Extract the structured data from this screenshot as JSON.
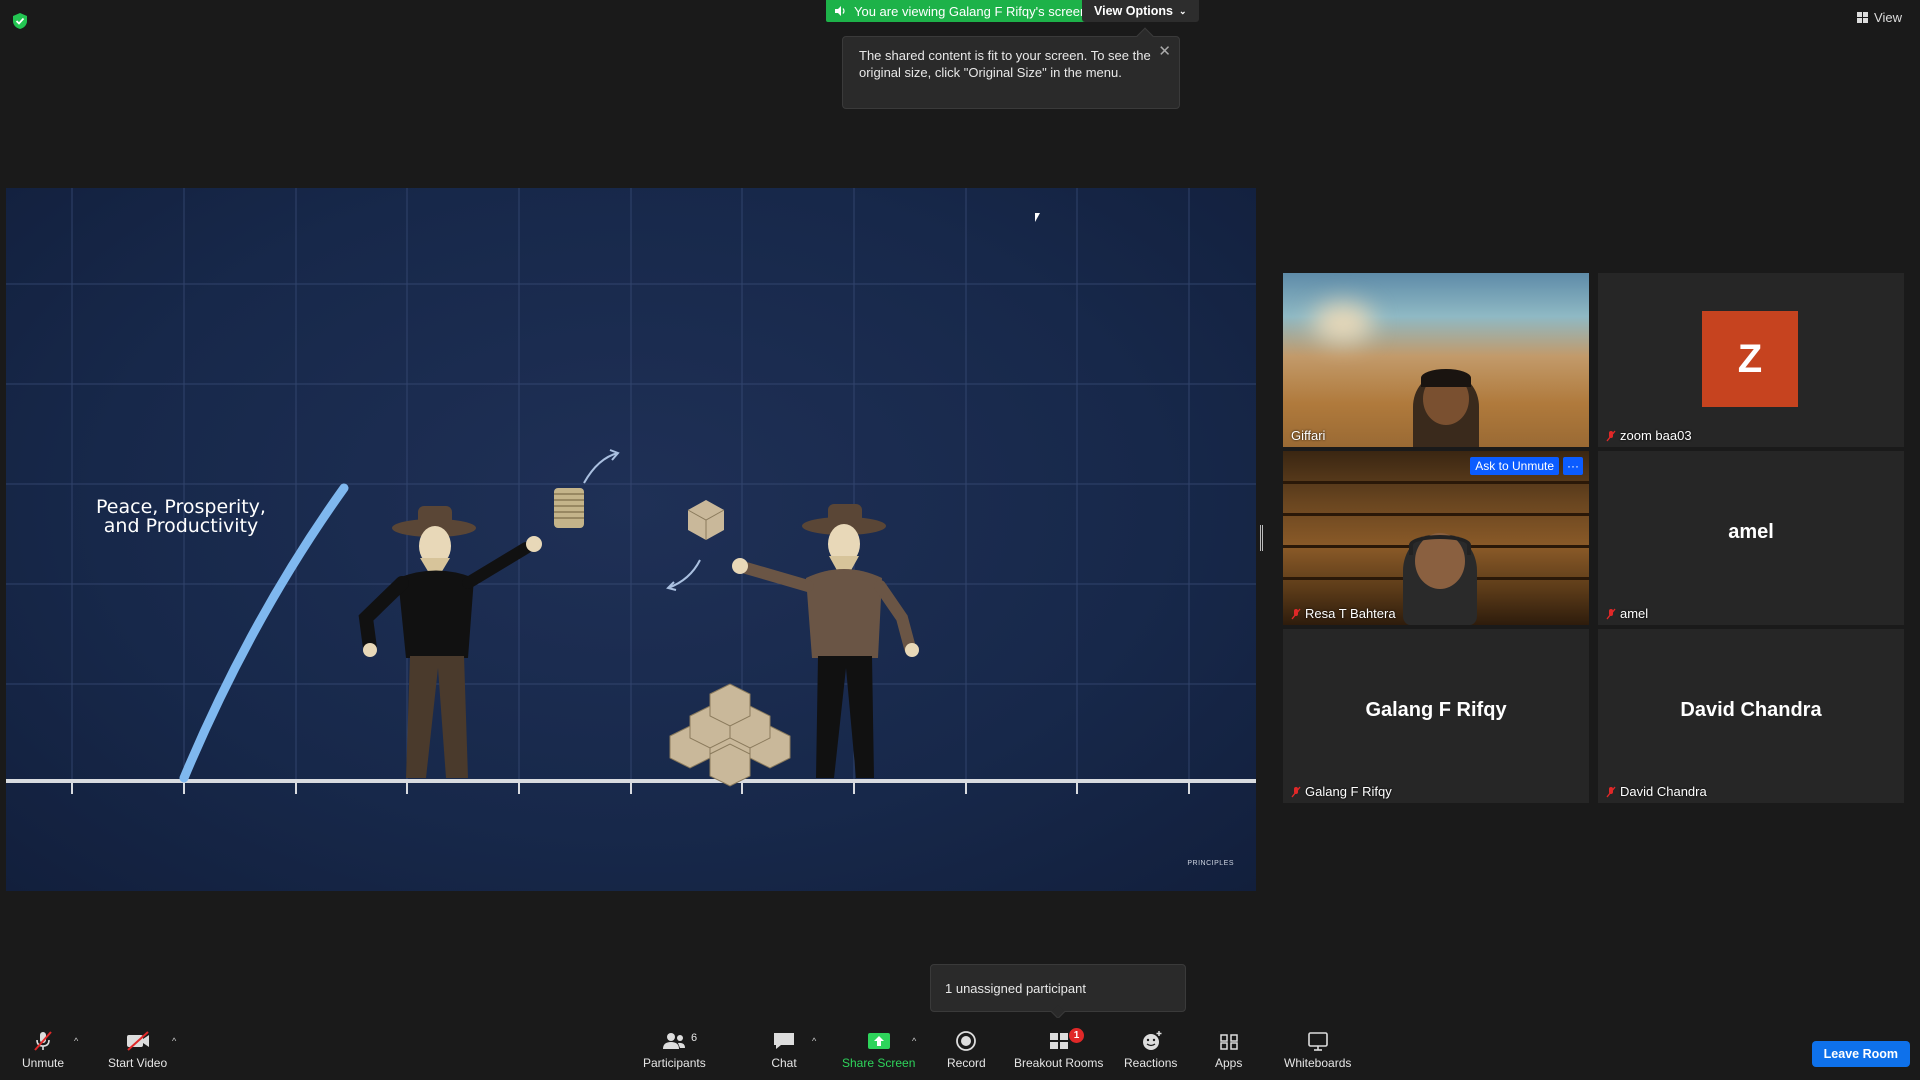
{
  "top": {
    "share_banner": "You are viewing Galang F Rifqy's screen",
    "view_options": "View Options",
    "view_button": "View"
  },
  "tooltip": {
    "text": "The shared content is fit to your screen. To see the original size, click \"Original Size\" in the menu."
  },
  "shared_screen": {
    "slide_title_line1": "Peace, Prosperity,",
    "slide_title_line2": "and Productivity",
    "watermark": "PRINCIPLES"
  },
  "gallery": {
    "tiles": [
      {
        "name": "Giffari",
        "muted": false,
        "video": true
      },
      {
        "name": "zoom baa03",
        "muted": true,
        "avatar_letter": "Z",
        "avatar_color": "#c6431f"
      },
      {
        "name": "Resa T Bahtera",
        "muted": true,
        "video": true,
        "ask_unmute": "Ask to Unmute",
        "more": "···"
      },
      {
        "name": "amel",
        "muted": true,
        "display_name": "amel"
      },
      {
        "name": "Galang F Rifqy",
        "muted": true,
        "display_name": "Galang F Rifqy"
      },
      {
        "name": "David Chandra",
        "muted": true,
        "display_name": "David Chandra"
      }
    ],
    "active_speaker_color": "#c9e85a"
  },
  "popup": {
    "unassigned": "1 unassigned participant"
  },
  "toolbar": {
    "unmute": "Unmute",
    "start_video": "Start Video",
    "participants": "Participants",
    "participants_count": "6",
    "chat": "Chat",
    "share_screen": "Share Screen",
    "record": "Record",
    "breakout_rooms": "Breakout Rooms",
    "breakout_badge": "1",
    "reactions": "Reactions",
    "apps": "Apps",
    "whiteboards": "Whiteboards",
    "leave": "Leave Room"
  },
  "colors": {
    "share_green": "#1db249",
    "leave_blue": "#0e71eb",
    "unmute_red": "#e02828"
  }
}
